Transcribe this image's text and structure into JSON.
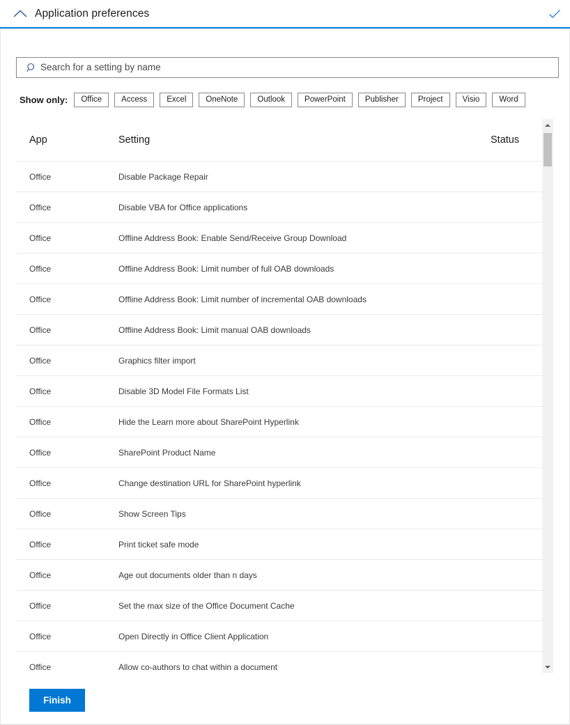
{
  "header": {
    "title": "Application preferences",
    "collapse_icon": "chevron-up-icon",
    "confirm_icon": "checkmark-icon",
    "accent_color": "#0078d4"
  },
  "search": {
    "placeholder": "Search for a setting by name",
    "value": "",
    "icon": "search-icon"
  },
  "filters": {
    "label": "Show only:",
    "buttons": [
      {
        "label": "Office"
      },
      {
        "label": "Access"
      },
      {
        "label": "Excel"
      },
      {
        "label": "OneNote"
      },
      {
        "label": "Outlook"
      },
      {
        "label": "PowerPoint"
      },
      {
        "label": "Publisher"
      },
      {
        "label": "Project"
      },
      {
        "label": "Visio"
      },
      {
        "label": "Word"
      }
    ]
  },
  "table": {
    "columns": [
      "App",
      "Setting",
      "Status"
    ],
    "rows": [
      {
        "app": "Office",
        "setting": "Disable Package Repair",
        "status": ""
      },
      {
        "app": "Office",
        "setting": "Disable VBA for Office applications",
        "status": ""
      },
      {
        "app": "Office",
        "setting": "Offline Address Book: Enable Send/Receive Group Download",
        "status": ""
      },
      {
        "app": "Office",
        "setting": "Offline Address Book: Limit number of full OAB downloads",
        "status": ""
      },
      {
        "app": "Office",
        "setting": "Offline Address Book: Limit number of incremental OAB downloads",
        "status": ""
      },
      {
        "app": "Office",
        "setting": "Offline Address Book: Limit manual OAB downloads",
        "status": ""
      },
      {
        "app": "Office",
        "setting": "Graphics filter import",
        "status": ""
      },
      {
        "app": "Office",
        "setting": "Disable 3D Model File Formats List",
        "status": ""
      },
      {
        "app": "Office",
        "setting": "Hide the Learn more about SharePoint Hyperlink",
        "status": ""
      },
      {
        "app": "Office",
        "setting": "SharePoint Product Name",
        "status": ""
      },
      {
        "app": "Office",
        "setting": "Change destination URL for SharePoint hyperlink",
        "status": ""
      },
      {
        "app": "Office",
        "setting": "Show Screen Tips",
        "status": ""
      },
      {
        "app": "Office",
        "setting": "Print ticket safe mode",
        "status": ""
      },
      {
        "app": "Office",
        "setting": "Age out documents older than n days",
        "status": ""
      },
      {
        "app": "Office",
        "setting": "Set the max size of the Office Document Cache",
        "status": ""
      },
      {
        "app": "Office",
        "setting": "Open Directly in Office Client Application",
        "status": ""
      },
      {
        "app": "Office",
        "setting": "Allow co-authors to chat within a document",
        "status": ""
      }
    ]
  },
  "scrollbar": {
    "up_icon": "scroll-up-arrow-icon",
    "down_icon": "scroll-down-arrow-icon"
  },
  "footer": {
    "finish_label": "Finish",
    "finish_color": "#0078d4"
  }
}
